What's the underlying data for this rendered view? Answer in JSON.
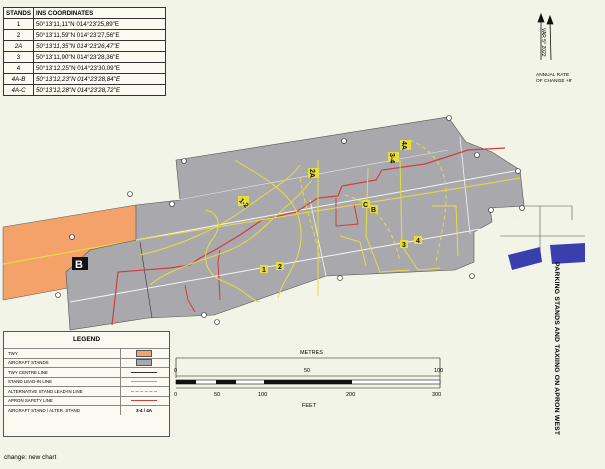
{
  "title": "PARKING STANDS AND TAXIING ON APRON WEST",
  "coordinates_table": {
    "headers": [
      "STANDS",
      "INS COORDINATES"
    ],
    "rows": [
      {
        "stand": "1",
        "coords": "50°13'11,11\"N  014°23'25,89\"E"
      },
      {
        "stand": "2",
        "coords": "50°13'11,59\"N  014°23'27,56\"E"
      },
      {
        "stand": "2A",
        "coords": "50°13'11,35\"N  014°23'26,47\"E"
      },
      {
        "stand": "3",
        "coords": "50°13'11,90\"N  014°23'28,36\"E"
      },
      {
        "stand": "4",
        "coords": "50°13'12,25\"N  014°23'30,09\"E"
      },
      {
        "stand": "4A-B",
        "coords": "50°13'12,23\"N  014°23'28,84\"E"
      },
      {
        "stand": "4A-C",
        "coords": "50°13'12,28\"N  014°23'28,72\"E"
      }
    ]
  },
  "north": {
    "var_label": "VAR 5° 2022",
    "rate_line1": "ANNUAL RATE",
    "rate_line2": "OF CHANGE +9'"
  },
  "map_labels": {
    "taxiway": "B",
    "stand_1": "1",
    "stand_2": "2",
    "stand_2A": "2A",
    "stand_3": "3",
    "stand_4": "4",
    "stand_1_2": "1-2",
    "stand_3_4": "3-4",
    "stand_4A": "4A",
    "stand_C": "C",
    "stand_B": "B"
  },
  "legend": {
    "title": "LEGEND",
    "items": [
      {
        "label": "TWY",
        "symbol": "swatch",
        "color": "#f4a16a"
      },
      {
        "label": "AIRCRAFT STANDS",
        "symbol": "swatch",
        "color": "#a9a9ad"
      },
      {
        "label": "TWY CENTRE LINE",
        "symbol": "line",
        "color": "#e6dd3c"
      },
      {
        "label": "STAND LEAD-IN LINE",
        "symbol": "line",
        "color": "#e6dd3c"
      },
      {
        "label": "ALTERNATIVE STAND LEAD-IN LINE",
        "symbol": "dashed",
        "color": "#e6dd3c"
      },
      {
        "label": "APRON SAFETY LINE",
        "symbol": "line",
        "color": "#d63a3a"
      },
      {
        "label": "AIRCRAFT STAND / ALTER. STAND",
        "symbol": "text",
        "text": "3-4 / 4A"
      }
    ]
  },
  "scale": {
    "metres_label": "METRES",
    "feet_label": "FEET",
    "metres_ticks": [
      "0",
      "50",
      "100"
    ],
    "feet_ticks": [
      "0",
      "50",
      "100",
      "200",
      "300"
    ]
  },
  "footer_text": "change: new chart",
  "colors": {
    "apron": "#a9a9ad",
    "taxiway": "#f4a16a",
    "yellow_line": "#e6dd3c",
    "red_line": "#d63a3a",
    "building": "#3a3fae",
    "background": "#f2f4e7"
  }
}
